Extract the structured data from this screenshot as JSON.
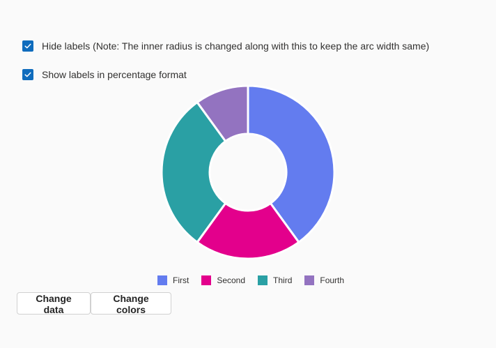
{
  "controls": {
    "hide_labels": {
      "label": "Hide labels (Note: The inner radius is changed along with this to keep the arc width same)",
      "checked": true
    },
    "show_percentage": {
      "label": "Show labels in percentage format",
      "checked": true
    }
  },
  "buttons": {
    "change_data": "Change data",
    "change_colors": "Change colors"
  },
  "chart_data": {
    "type": "pie",
    "donut": true,
    "categories": [
      "First",
      "Second",
      "Third",
      "Fourth"
    ],
    "values": [
      40,
      20,
      30,
      10
    ],
    "colors": [
      "#637cef",
      "#e3008c",
      "#2aa0a4",
      "#9373c0"
    ],
    "legend": "bottom"
  }
}
